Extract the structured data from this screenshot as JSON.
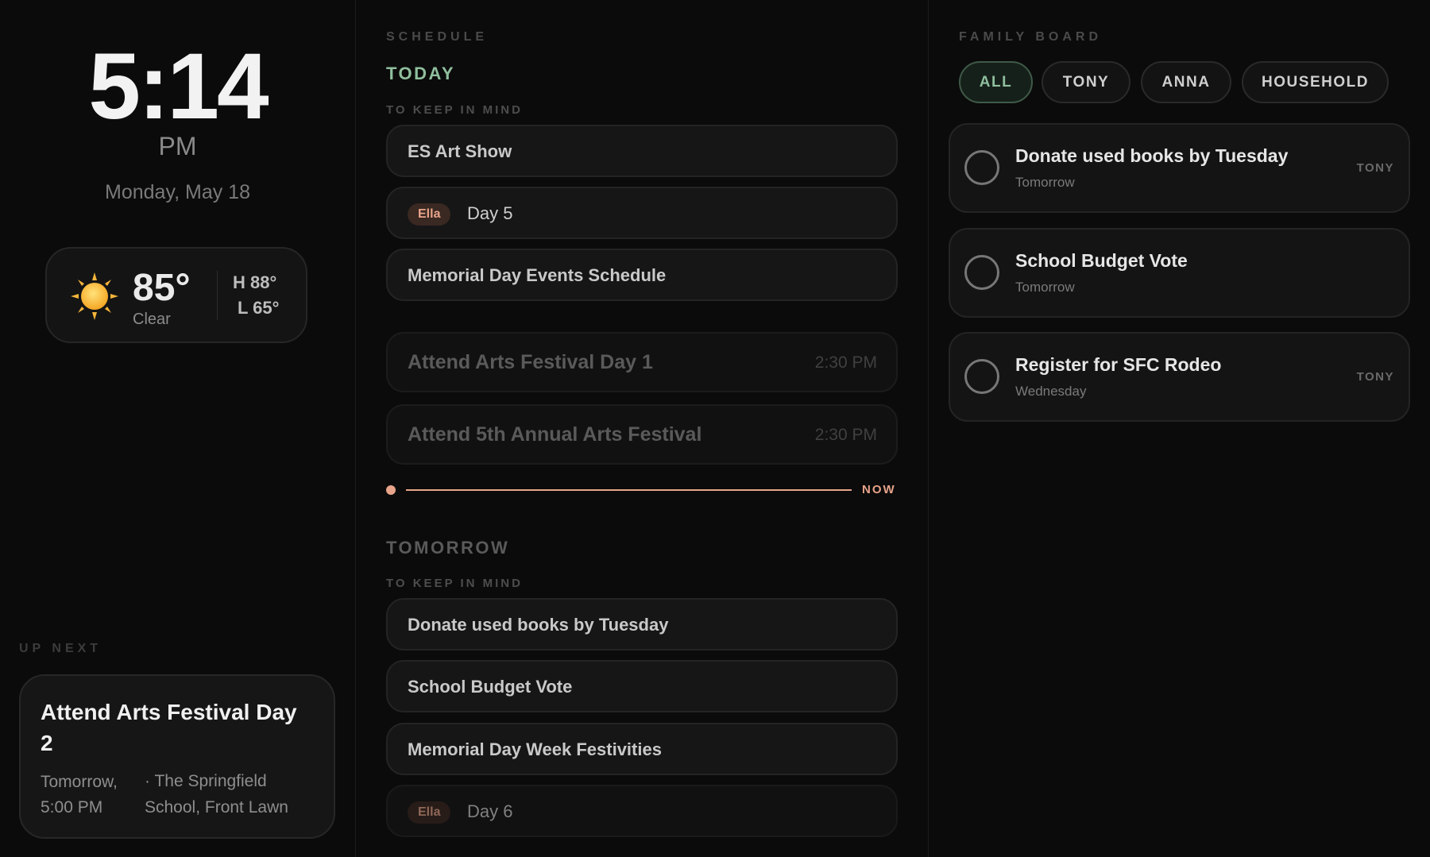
{
  "clock": {
    "time": "5:14",
    "ampm": "PM",
    "date": "Monday, May 18"
  },
  "weather": {
    "icon": "sun-icon",
    "temp": "85°",
    "condition": "Clear",
    "high": "H 88°",
    "low": "L 65°"
  },
  "up_next": {
    "label": "UP NEXT",
    "title": "Attend Arts Festival Day 2",
    "when": "Tomorrow, 5:00 PM",
    "where": "· The Springfield School, Front Lawn"
  },
  "schedule": {
    "label": "SCHEDULE",
    "today": {
      "label": "TODAY",
      "keep_label": "TO KEEP IN MIND",
      "keep_items": [
        {
          "text": "ES Art Show"
        },
        {
          "tag": "Ella",
          "text": "Day 5"
        },
        {
          "text": "Memorial Day Events Schedule"
        }
      ],
      "events": [
        {
          "title": "Attend Arts Festival Day 1",
          "time": "2:30 PM"
        },
        {
          "title": "Attend 5th Annual Arts Festival",
          "time": "2:30 PM"
        }
      ],
      "now_label": "NOW"
    },
    "tomorrow": {
      "label": "TOMORROW",
      "keep_label": "TO KEEP IN MIND",
      "keep_items": [
        {
          "text": "Donate used books by Tuesday"
        },
        {
          "text": "School Budget Vote"
        },
        {
          "text": "Memorial Day Week Festivities"
        },
        {
          "tag": "Ella",
          "text": "Day 6"
        }
      ]
    }
  },
  "board": {
    "label": "FAMILY BOARD",
    "filters": [
      "ALL",
      "TONY",
      "ANNA",
      "HOUSEHOLD"
    ],
    "active_filter": "ALL",
    "tasks": [
      {
        "title": "Donate used books by Tuesday",
        "due": "Tomorrow",
        "who": "TONY"
      },
      {
        "title": "School Budget Vote",
        "due": "Tomorrow",
        "who": ""
      },
      {
        "title": "Register for SFC Rodeo",
        "due": "Wednesday",
        "who": "TONY"
      }
    ]
  },
  "colors": {
    "accent_green": "#8fbf9e",
    "now_accent": "#e8a48a",
    "background": "#0b0b0b"
  }
}
